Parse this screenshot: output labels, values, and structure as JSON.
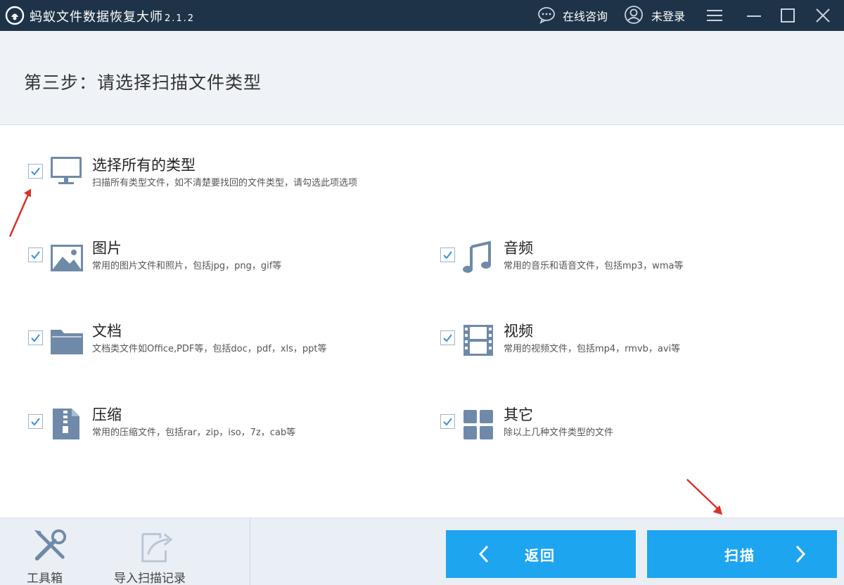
{
  "window": {
    "title": "蚂蚁文件数据恢复大师",
    "version": "2.1.2",
    "consult_label": "在线咨询",
    "login_label": "未登录"
  },
  "step": {
    "title": "第三步：请选择扫描文件类型"
  },
  "options": {
    "all": {
      "label": "选择所有的类型",
      "desc": "扫描所有类型文件，如不清楚要找回的文件类型，请勾选此项选项",
      "checked": true,
      "icon": "monitor-icon"
    },
    "image": {
      "label": "图片",
      "desc": "常用的图片文件和照片，包括jpg，png，gif等",
      "checked": true,
      "icon": "image-icon"
    },
    "audio": {
      "label": "音频",
      "desc": "常用的音乐和语音文件，包括mp3，wma等",
      "checked": true,
      "icon": "music-note-icon"
    },
    "doc": {
      "label": "文档",
      "desc": "文档类文件如Office,PDF等，包括doc，pdf，xls，ppt等",
      "checked": true,
      "icon": "folder-icon"
    },
    "video": {
      "label": "视频",
      "desc": "常用的视频文件，包括mp4，rmvb，avi等",
      "checked": true,
      "icon": "film-icon"
    },
    "zip": {
      "label": "压缩",
      "desc": "常用的压缩文件，包括rar，zip，iso，7z，cab等",
      "checked": true,
      "icon": "zip-file-icon"
    },
    "other": {
      "label": "其它",
      "desc": "除以上几种文件类型的文件",
      "checked": true,
      "icon": "grid-icon"
    }
  },
  "footer": {
    "toolbox_label": "工具箱",
    "import_label": "导入扫描记录",
    "back_label": "返回",
    "scan_label": "扫描"
  },
  "colors": {
    "titlebar": "#1e3347",
    "accent": "#1da5f0",
    "icon": "#6f8aa8",
    "annotation_arrow": "#d9312a"
  }
}
